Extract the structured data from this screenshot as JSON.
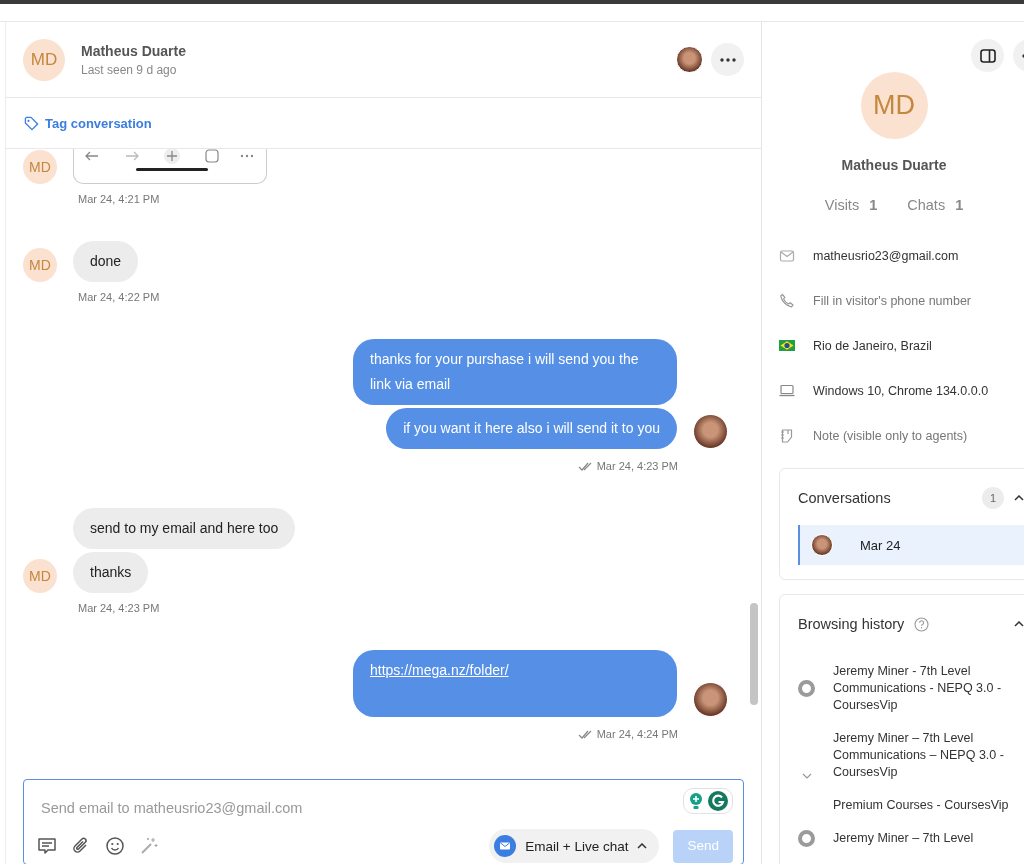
{
  "header": {
    "initials": "MD",
    "name": "Matheus Duarte",
    "status": "Last seen 9 d ago"
  },
  "tag_link": "Tag conversation",
  "messages": [
    {
      "kind": "visitor",
      "initials": "MD",
      "items": [
        {
          "kind": "image"
        }
      ],
      "time": "Mar 24, 4:21 PM"
    },
    {
      "kind": "visitor",
      "initials": "MD",
      "items": [
        {
          "kind": "text",
          "text": "done"
        }
      ],
      "time": "Mar 24, 4:22 PM"
    },
    {
      "kind": "agent",
      "items": [
        {
          "kind": "text",
          "text": "thanks for your purshase i will send you the link via email"
        },
        {
          "kind": "text",
          "text": "if you want it here also i will send it to you"
        }
      ],
      "time": "Mar 24, 4:23 PM",
      "read": true
    },
    {
      "kind": "visitor",
      "initials": "MD",
      "items": [
        {
          "kind": "text",
          "text": "send to my email and here too"
        },
        {
          "kind": "text",
          "text": "thanks"
        }
      ],
      "time": "Mar 24, 4:23 PM"
    },
    {
      "kind": "agent",
      "items": [
        {
          "kind": "link",
          "text": "https://mega.nz/folder/"
        }
      ],
      "time": "Mar 24, 4:24 PM",
      "read": true
    }
  ],
  "composer": {
    "placeholder": "Send email to matheusrio23@gmail.com",
    "channel": "Email + Live chat",
    "send": "Send",
    "send_disabled": true
  },
  "profile": {
    "initials": "MD",
    "name": "Matheus Duarte",
    "stats": [
      {
        "label": "Visits",
        "value": "1"
      },
      {
        "label": "Chats",
        "value": "1"
      }
    ],
    "details": [
      {
        "kind": "email",
        "text": "matheusrio23@gmail.com"
      },
      {
        "kind": "phone",
        "placeholder": "Fill in visitor's phone number"
      },
      {
        "kind": "location",
        "text": "Rio de Janeiro, Brazil"
      },
      {
        "kind": "device",
        "text": "Windows 10, Chrome 134.0.0.0"
      },
      {
        "kind": "note",
        "placeholder": "Note (visible only to agents)"
      }
    ]
  },
  "conversations": {
    "title": "Conversations",
    "count": "1",
    "expanded": true,
    "items": [
      {
        "date": "Mar 24",
        "selected": true
      }
    ]
  },
  "browsing_history": {
    "title": "Browsing history",
    "expanded": true,
    "items": [
      {
        "title": "Jeremy Miner - 7th Level Communications - NEPQ 3.0 - CoursesVip",
        "marker": true
      },
      {
        "title": "Jeremy Miner – 7th Level Communications – NEPQ 3.0 - CoursesVip",
        "marker": false
      },
      {
        "title": "Premium Courses - CoursesVip",
        "marker": false
      },
      {
        "title": "Jeremy Miner – 7th Level",
        "marker": true
      }
    ]
  }
}
